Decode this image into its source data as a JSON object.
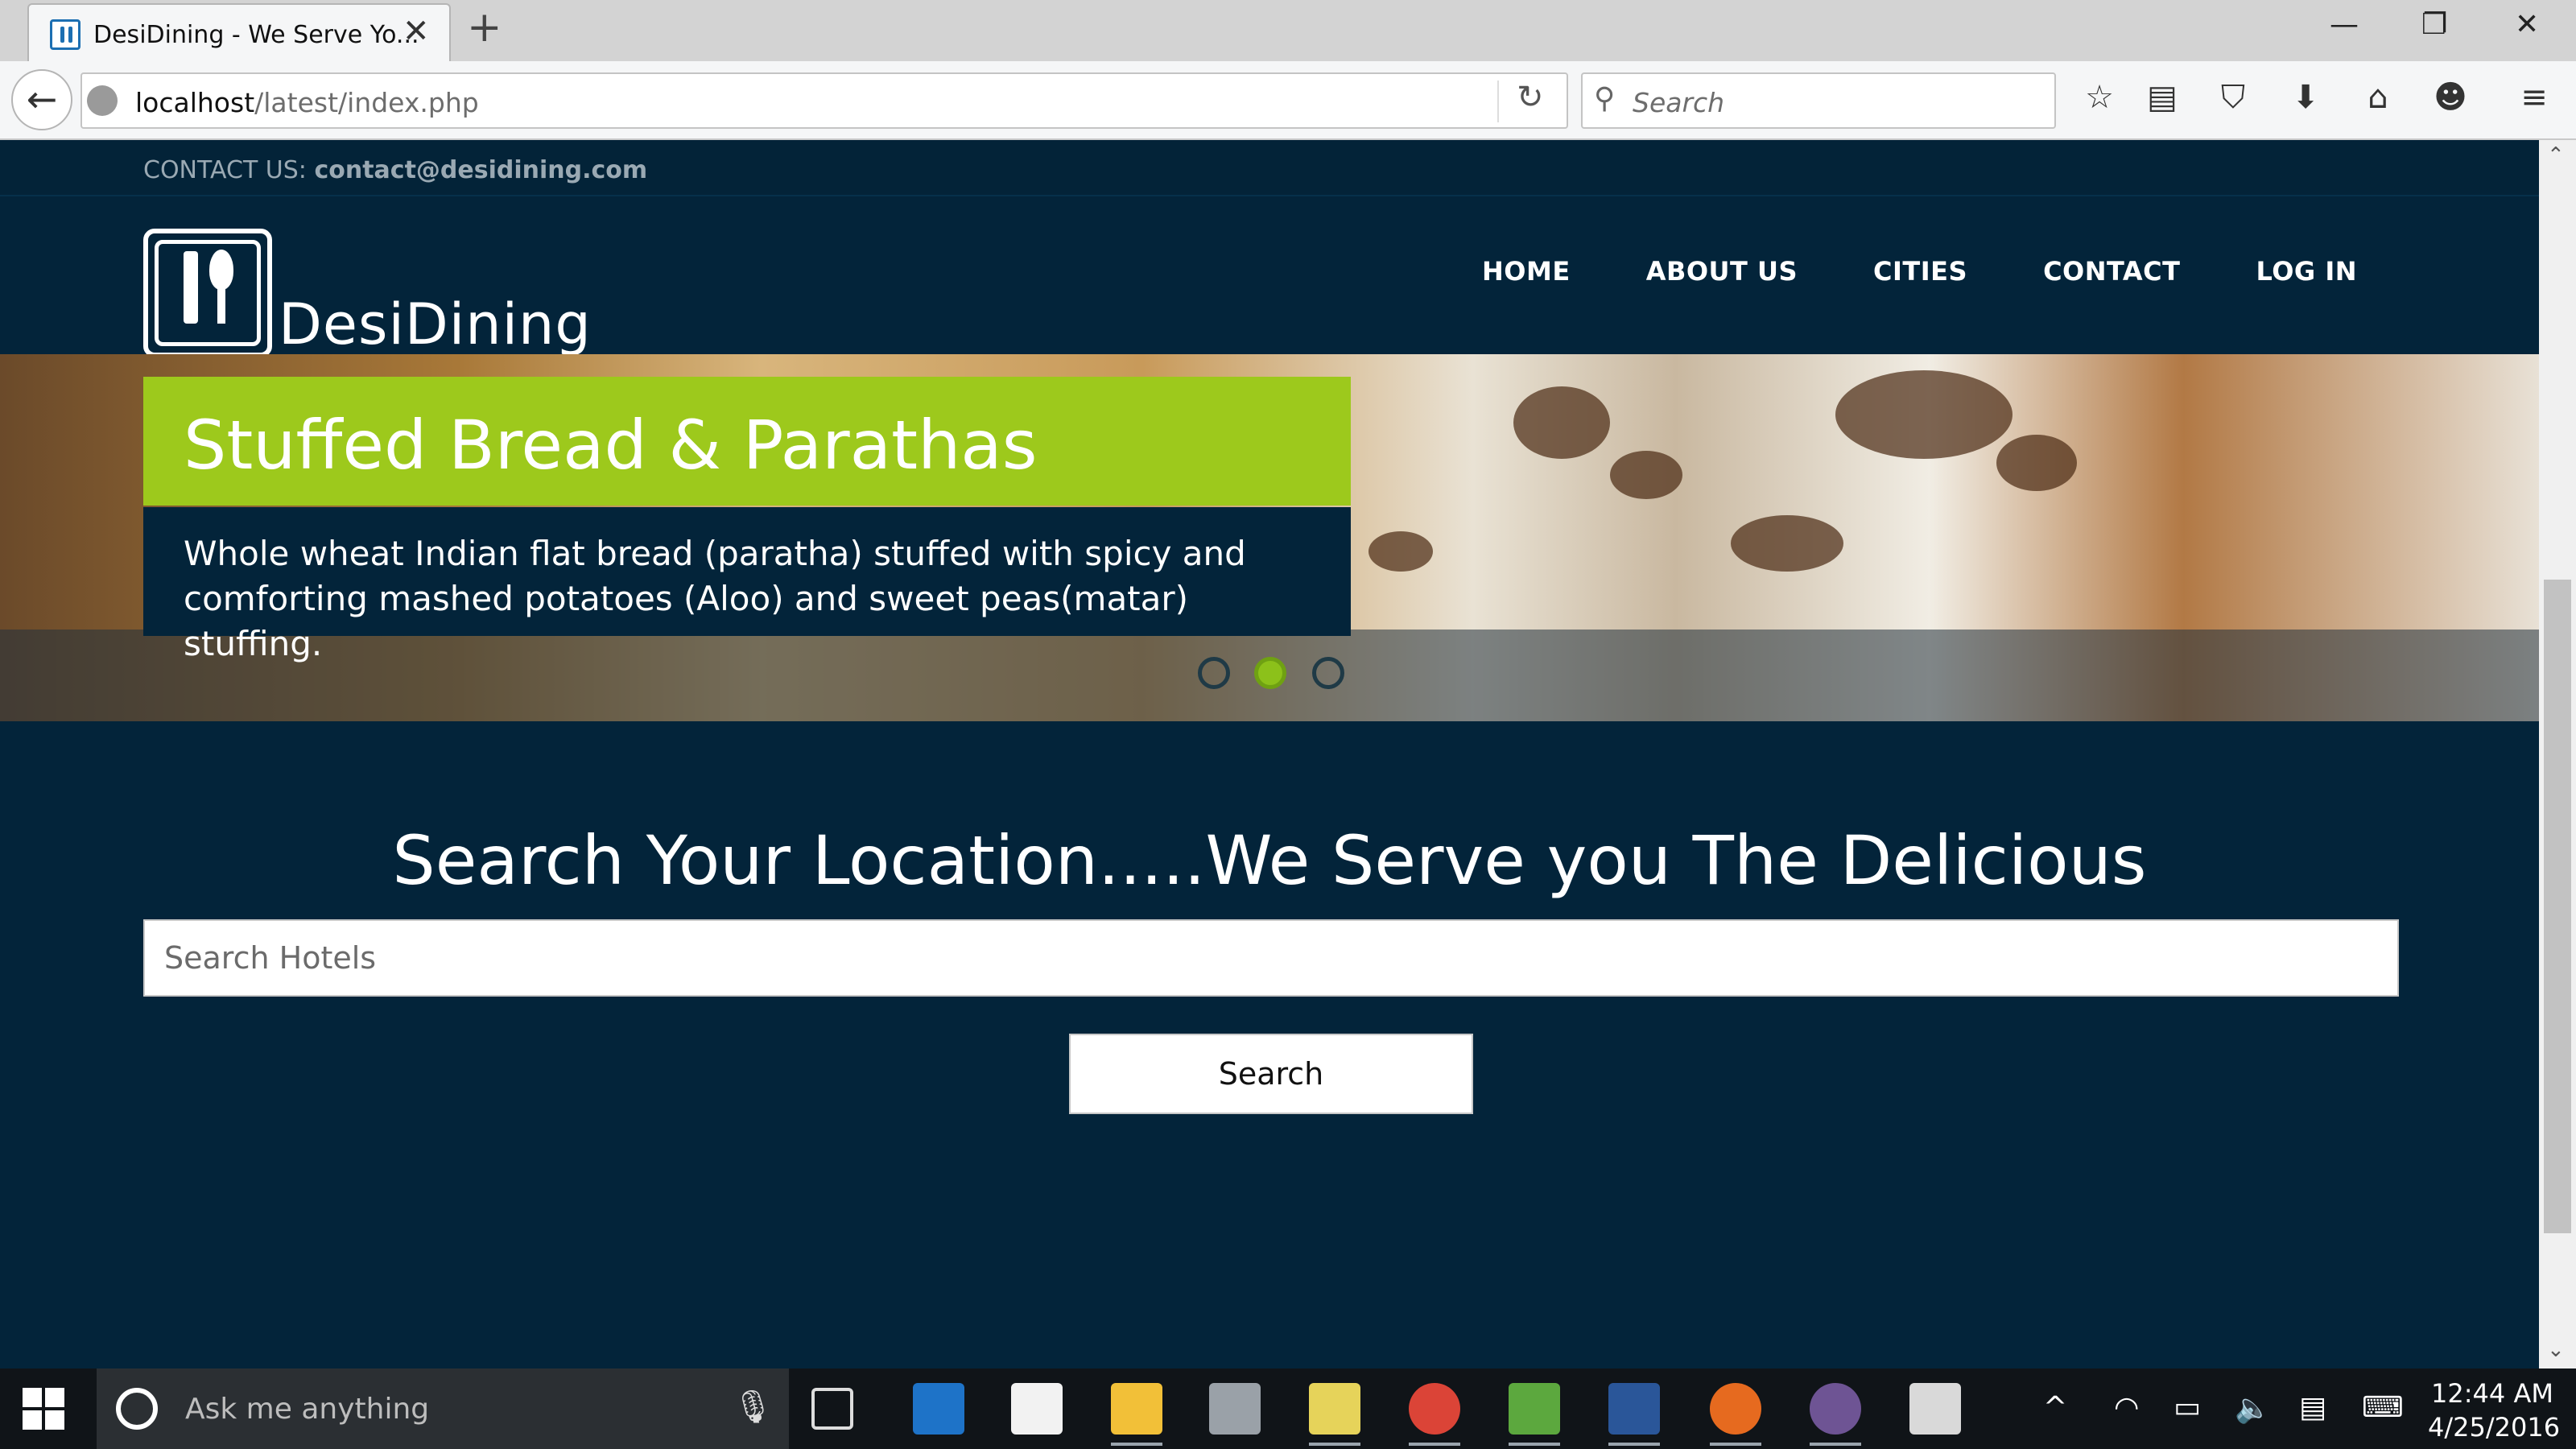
{
  "browser": {
    "tab_title": "DesiDining - We Serve Yo...",
    "url_host": "localhost",
    "url_path": "/latest/index.php",
    "search_placeholder": "Search"
  },
  "site": {
    "contact_label": "CONTACT US:",
    "contact_email": "contact@desidining.com",
    "brand": "DesiDining",
    "nav": [
      "HOME",
      "ABOUT US",
      "CITIES",
      "CONTACT",
      "LOG IN"
    ],
    "slider": {
      "title": "Stuffed Bread & Parathas",
      "description": "Whole wheat Indian flat bread (paratha) stuffed with spicy and comforting mashed potatoes (Aloo) and sweet peas(matar) stuffing.",
      "active_dot": 2,
      "dot_count": 3
    },
    "search_heading": "Search Your Location.....We Serve you The Delicious",
    "search_placeholder": "Search Hotels",
    "search_button": "Search"
  },
  "taskbar": {
    "cortana_placeholder": "Ask me anything",
    "time": "12:44 AM",
    "date": "4/25/2016"
  },
  "colors": {
    "page_bg": "#03243a",
    "accent_green": "#9dc91c"
  }
}
